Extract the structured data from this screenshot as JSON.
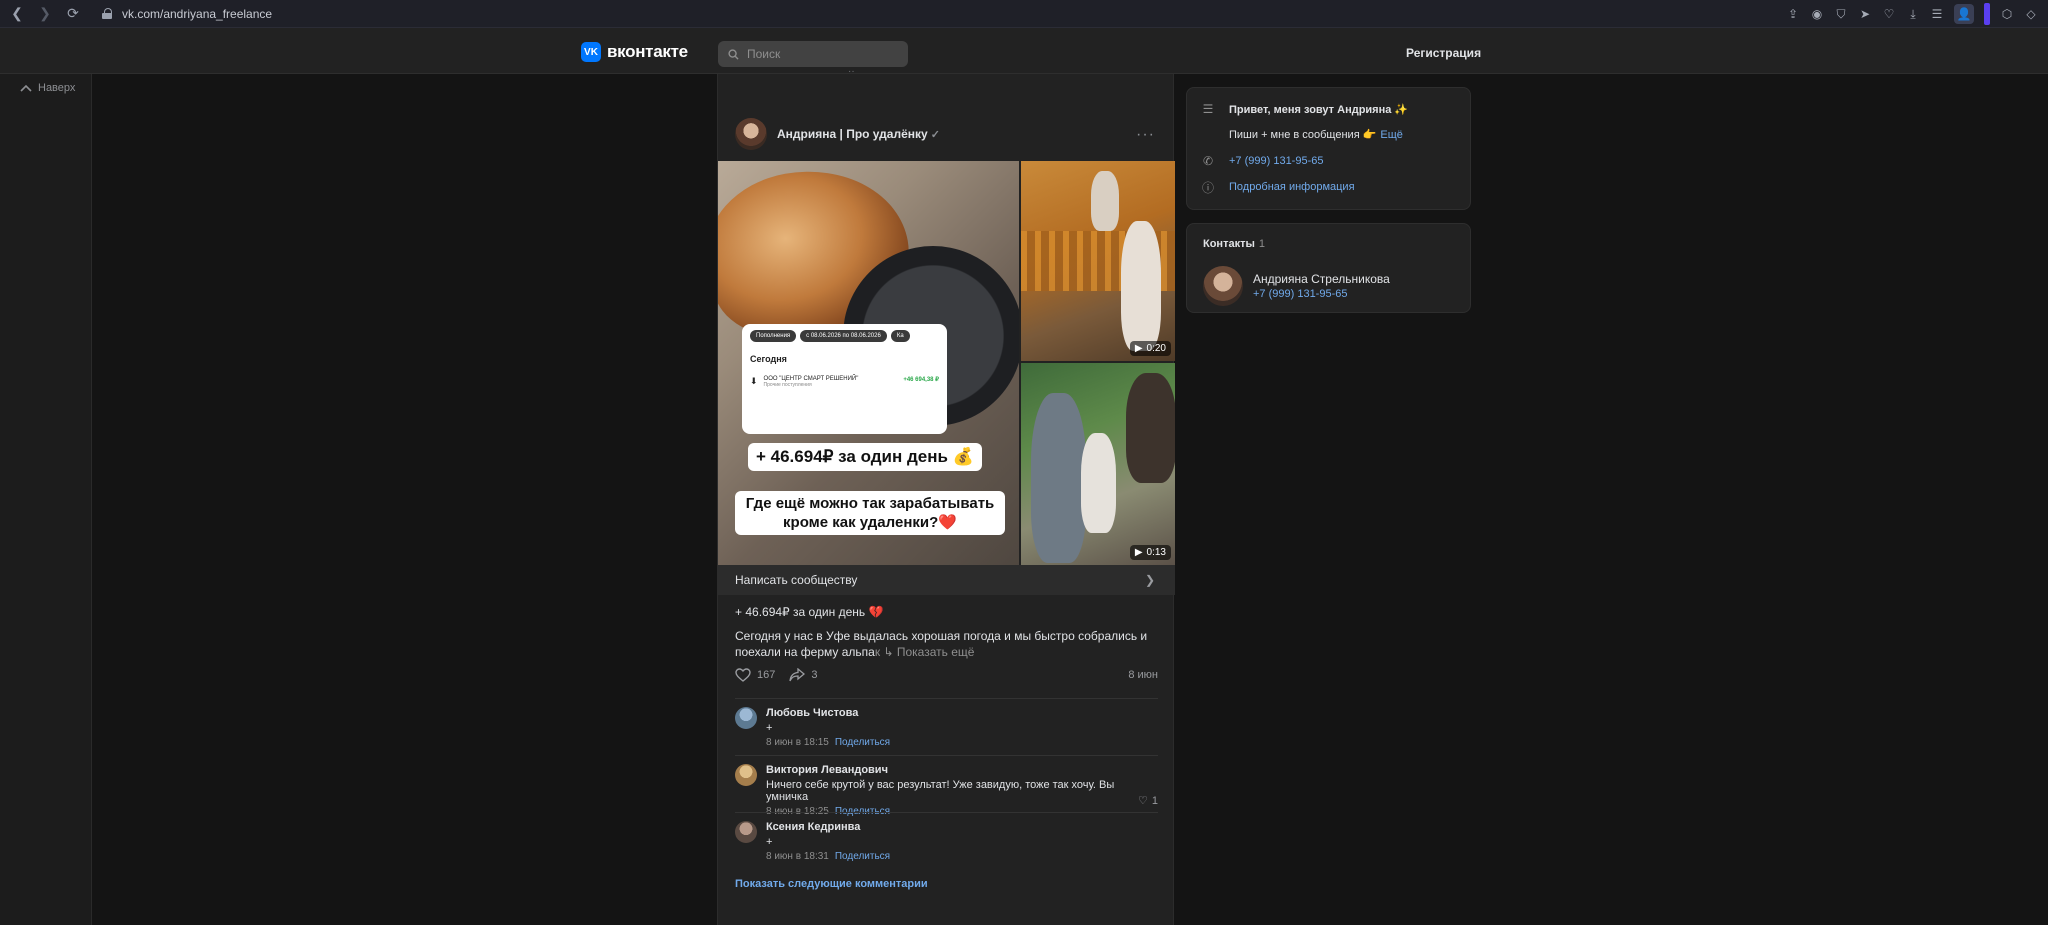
{
  "browser": {
    "url": "vk.com/andriyana_freelance"
  },
  "header": {
    "logo_text": "вконтакте",
    "logo_mark": "VK",
    "search_placeholder": "Поиск",
    "register_label": "Регистрация"
  },
  "left_rail": {
    "to_top_label": "Наверх"
  },
  "post": {
    "author": "Андрияна | Про удалёнку",
    "more_label": "···",
    "media": {
      "card": {
        "chip1": "Пополнения",
        "chip2": "с 08.06.2026 по 08.06.2026",
        "chip3": "Ка",
        "today_label": "Сегодня",
        "payer": "ООО \"ЦЕНТР СМАРТ РЕШЕНИЙ\"",
        "payer_sub": "Прочие поступления",
        "amount": "+46 694,38 ₽"
      },
      "caption1": "+ 46.694₽ за один день 💰",
      "caption2": "Где ещё можно так зарабатывать кроме как удаленки?❤️",
      "video1_duration": "0:20",
      "video2_duration": "0:13"
    },
    "write_label": "Написать сообществу",
    "title": "+ 46.694₽ за один день 💔",
    "text_main": "Сегодня у нас в Уфе выдалась хорошая погода и мы быстро собрались и поехали на ферму альпа",
    "text_fade": "к",
    "show_more": "Показать ещё",
    "likes": "167",
    "shares": "3",
    "date": "8 июн"
  },
  "comments": [
    {
      "name": "Любовь Чистова",
      "text": "+",
      "time": "8 июн в 18:15",
      "share": "Поделиться"
    },
    {
      "name": "Виктория Левандович",
      "text": "Ничего себе крутой у вас результат! Уже завидую, тоже так хочу. Вы умничка",
      "time": "8 июн в 18:25",
      "share": "Поделиться",
      "likes": "1"
    },
    {
      "name": "Ксения Кедринва",
      "text": "+",
      "time": "8 июн в 18:31",
      "share": "Поделиться"
    }
  ],
  "show_next_comments": "Показать следующие комментарии",
  "info": {
    "greeting": "Привет, меня зовут Андрияна ✨",
    "write_me": "Пиши + мне в сообщения 👉",
    "more": "Ещё",
    "phone": "+7 (999) 131-95-65",
    "details": "Подробная информация"
  },
  "contacts": {
    "title": "Контакты",
    "count": "1",
    "name": "Андрияна Стрельникова",
    "phone": "+7 (999) 131-95-65"
  },
  "colors": {
    "accent": "#0077ff",
    "link": "#71aaeb",
    "background": "#141414",
    "panel": "#222222"
  }
}
